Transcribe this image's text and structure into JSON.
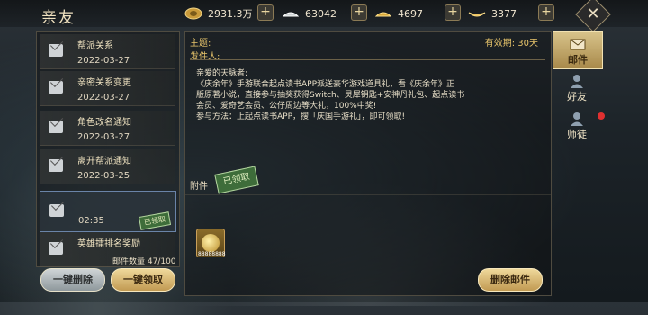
{
  "header": {
    "title": "亲友"
  },
  "resources": [
    {
      "name": "coin-icon",
      "value": "2931.3万",
      "color": "#c99a3a"
    },
    {
      "name": "silver-ingot-icon",
      "value": "63042",
      "color": "#cfd4d6"
    },
    {
      "name": "gold-ingot-icon",
      "value": "4697",
      "color": "#d9a93a"
    },
    {
      "name": "gold-sycee-icon",
      "value": "3377",
      "color": "#e0b046"
    }
  ],
  "close_symbol": "✕",
  "mail_list": [
    {
      "title": "帮派关系",
      "date": "2022-03-27",
      "claimed": false
    },
    {
      "title": "亲密关系变更",
      "date": "2022-03-27",
      "claimed": false
    },
    {
      "title": "角色改名通知",
      "date": "2022-03-27",
      "claimed": false
    },
    {
      "title": "离开帮派通知",
      "date": "2022-03-25",
      "claimed": false
    },
    {
      "title": "",
      "date": "02:35",
      "claimed": true,
      "stamp": "已领取"
    },
    {
      "title": "英雄擂排名奖励",
      "date": "",
      "claimed": false
    }
  ],
  "mail_count": "邮件数量 47/100",
  "buttons": {
    "delete_all": "一键删除",
    "claim_all": "一键领取",
    "delete_mail": "删除邮件"
  },
  "detail": {
    "subject_label": "主题:",
    "validity": "有效期: 30天",
    "sender_label": "发件人:",
    "body_lines": [
      "亲爱的天脉者:",
      "《庆余年》手游联合起点读书APP派送豪华游戏道具礼，看《庆余年》正",
      "版原著小说，直接参与抽奖获得Switch、灵犀钥匙+安神丹礼包、起点读书",
      "会员、爱奇艺会员、公仔周边等大礼，100%中奖!",
      "参与方法：上起点读书APP，搜「庆国手游礼」，即可领取!"
    ],
    "attachment_label": "附件",
    "claimed_stamp": "已领取",
    "attachment_qty": "88888888"
  },
  "tabs": [
    {
      "label": "邮件",
      "active": true,
      "icon": "mail-tab-icon"
    },
    {
      "label": "好友",
      "active": false,
      "icon": "friend-tab-icon"
    },
    {
      "label": "师徒",
      "active": false,
      "icon": "mentor-tab-icon",
      "badge": true
    }
  ]
}
